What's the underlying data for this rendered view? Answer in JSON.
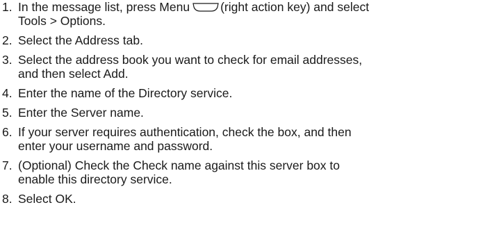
{
  "steps": [
    {
      "number": "1.",
      "line1_before_icon": "In the message list, press Menu",
      "icon": "right-action-key-icon",
      "line1_after_icon": "(right action key) and select",
      "line2": "Tools > Options."
    },
    {
      "number": "2.",
      "line1": "Select the Address tab."
    },
    {
      "number": "3.",
      "line1": "Select the address book you want to check for email addresses,",
      "line2": "and then select Add."
    },
    {
      "number": "4.",
      "line1": "Enter the name of the Directory service."
    },
    {
      "number": "5.",
      "line1": "Enter the Server name."
    },
    {
      "number": "6.",
      "line1": "If your server requires authentication, check the box, and then",
      "line2": "enter your username and password."
    },
    {
      "number": "7.",
      "line1": "(Optional) Check the Check name against this server box to",
      "line2": "enable this directory service."
    },
    {
      "number": "8.",
      "line1": "Select OK."
    }
  ]
}
